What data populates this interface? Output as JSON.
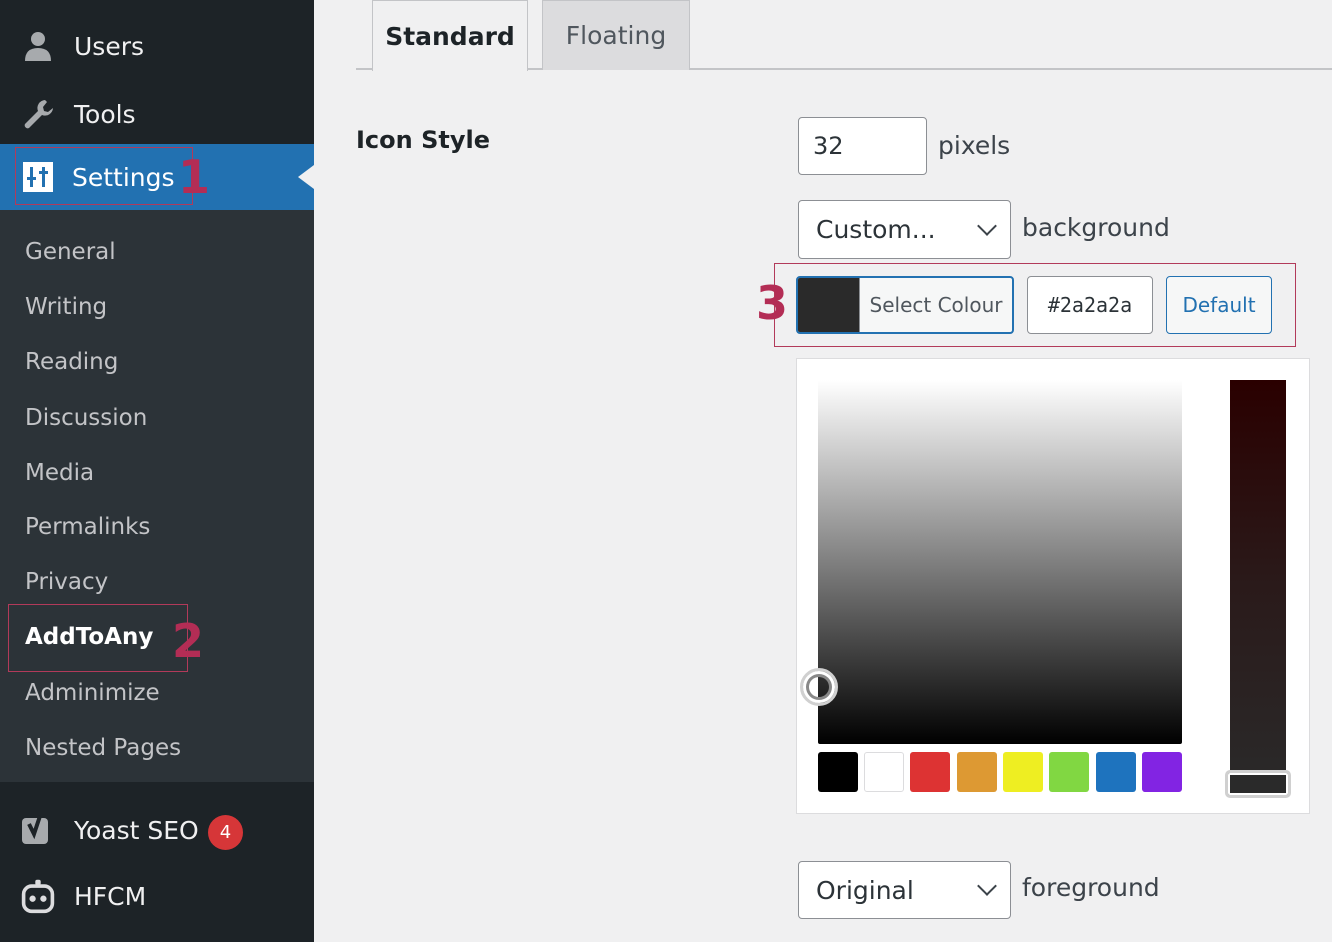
{
  "sidebar": {
    "top_items": [
      {
        "label": "Users"
      },
      {
        "label": "Tools"
      },
      {
        "label": "Settings"
      }
    ],
    "submenu": [
      {
        "label": "General"
      },
      {
        "label": "Writing"
      },
      {
        "label": "Reading"
      },
      {
        "label": "Discussion"
      },
      {
        "label": "Media"
      },
      {
        "label": "Permalinks"
      },
      {
        "label": "Privacy"
      },
      {
        "label": "AddToAny"
      },
      {
        "label": "Adminimize"
      },
      {
        "label": "Nested Pages"
      }
    ],
    "bottom_items": [
      {
        "label": "Yoast SEO",
        "badge": "4"
      },
      {
        "label": "HFCM"
      }
    ]
  },
  "annotations": {
    "one": "1",
    "two": "2",
    "three": "3"
  },
  "tabs": [
    {
      "label": "Standard",
      "active": true
    },
    {
      "label": "Floating",
      "active": false
    }
  ],
  "icon_style": {
    "label": "Icon Style",
    "size_value": "32",
    "size_unit": "pixels",
    "background_select": "Custom...",
    "background_label": "background",
    "select_colour_label": "Select Colour",
    "hex_value": "#2a2a2a",
    "default_label": "Default",
    "foreground_select": "Original",
    "foreground_label": "foreground"
  },
  "colors": {
    "sidebar_bg": "#1d2327",
    "active_menu": "#2271b1",
    "selected_color": "#2a2a2a",
    "badge": "#d63638",
    "annotation": "#b32d55",
    "palette": [
      "#000000",
      "#ffffff",
      "#dd3333",
      "#dd9933",
      "#eeee22",
      "#81d742",
      "#1e73be",
      "#8224e3"
    ]
  }
}
